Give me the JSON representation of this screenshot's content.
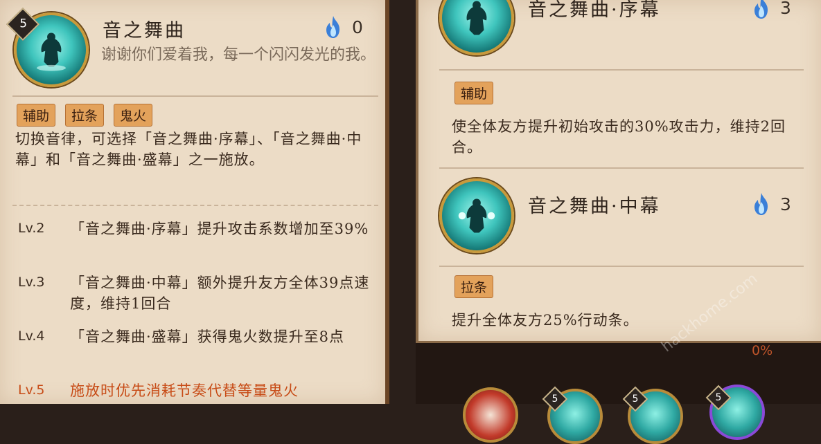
{
  "left": {
    "cost": "5",
    "title": "音之舞曲",
    "fire_count": "0",
    "description": "谢谢你们爱着我，每一个闪闪发光的我。",
    "tags": [
      "辅助",
      "拉条",
      "鬼火"
    ],
    "effect": "切换音律，可选择「音之舞曲·序幕」、「音之舞曲·中幕」和「音之舞曲·盛幕」之一施放。",
    "levels": [
      {
        "lv": "Lv.2",
        "text": "「音之舞曲·序幕」提升攻击系数增加至39%"
      },
      {
        "lv": "Lv.3",
        "text": "「音之舞曲·中幕」额外提升友方全体39点速度，维持1回合"
      },
      {
        "lv": "Lv.4",
        "text": "「音之舞曲·盛幕」获得鬼火数提升至8点"
      },
      {
        "lv": "Lv.5",
        "text": "施放时优先消耗节奏代替等量鬼火"
      }
    ]
  },
  "right": {
    "top": {
      "title": "音之舞曲·序幕",
      "fire_count": "3",
      "tag": "辅助",
      "effect": "使全体友方提升初始攻击的30%攻击力，维持2回合。"
    },
    "mid": {
      "title": "音之舞曲·中幕",
      "fire_count": "3",
      "tag": "拉条",
      "effect": "提升全体友方25%行动条。"
    }
  },
  "bottom": {
    "percent": "0%",
    "badges": [
      "5",
      "5",
      "5"
    ]
  },
  "watermark": "hackhome.com",
  "colors": {
    "panel": "#ecdcc6",
    "tag": "#e3a25b",
    "highlight": "#c74b16",
    "icon_teal": "#3fc5bd"
  }
}
